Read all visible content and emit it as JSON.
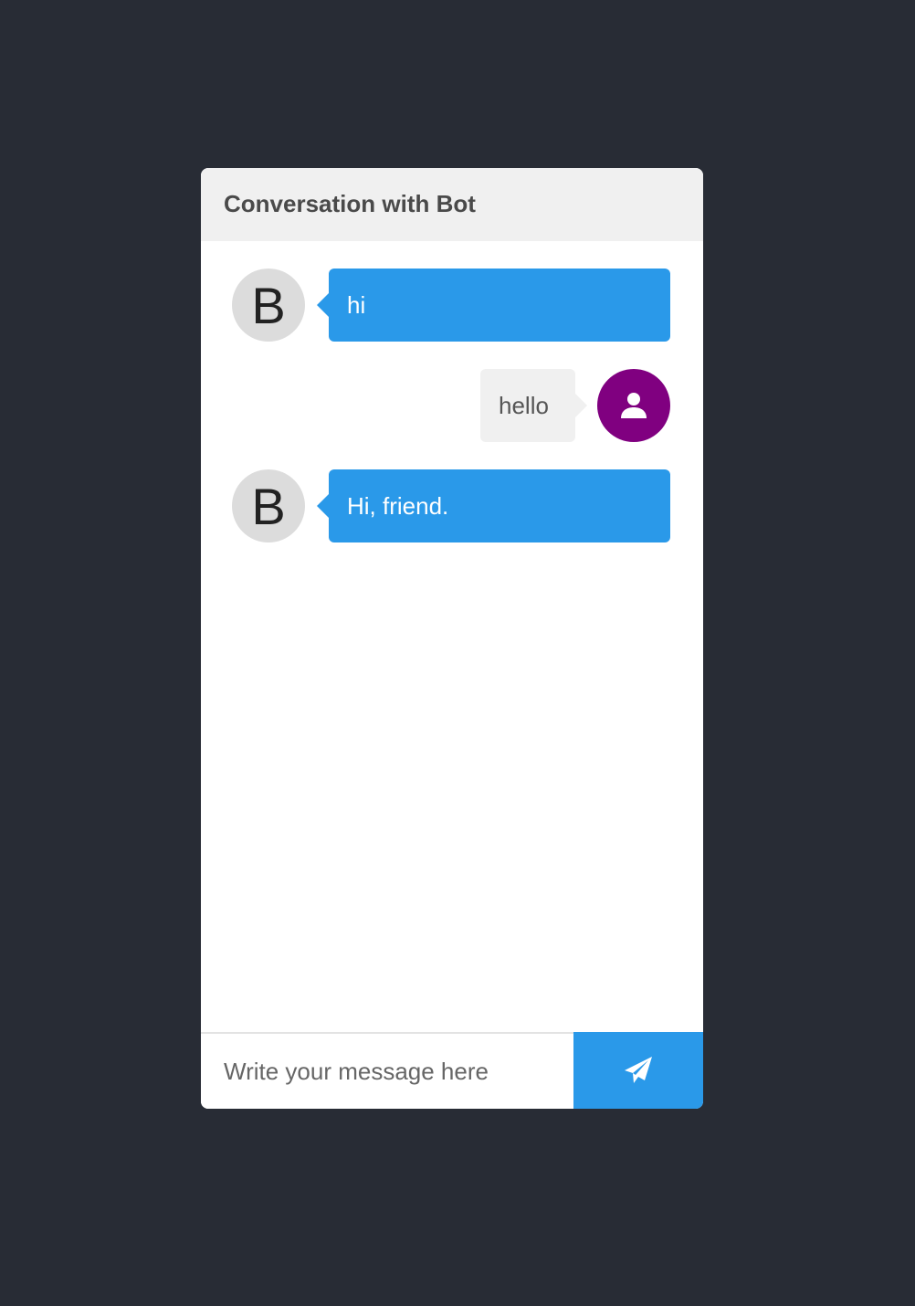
{
  "header": {
    "title": "Conversation with Bot"
  },
  "messages": [
    {
      "sender": "bot",
      "avatar_letter": "B",
      "text": "hi"
    },
    {
      "sender": "user",
      "avatar_icon": "user-icon",
      "text": "hello"
    },
    {
      "sender": "bot",
      "avatar_letter": "B",
      "text": "Hi, friend."
    }
  ],
  "composer": {
    "placeholder": "Write your message here",
    "value": "",
    "send_icon": "paper-plane-icon"
  },
  "colors": {
    "page_background": "#282c35",
    "header_background": "#f0f0f0",
    "bot_bubble": "#2a99e9",
    "user_bubble": "#f0f0f0",
    "bot_avatar": "#dcdcdc",
    "user_avatar": "#800080",
    "send_button": "#2a99e9"
  }
}
